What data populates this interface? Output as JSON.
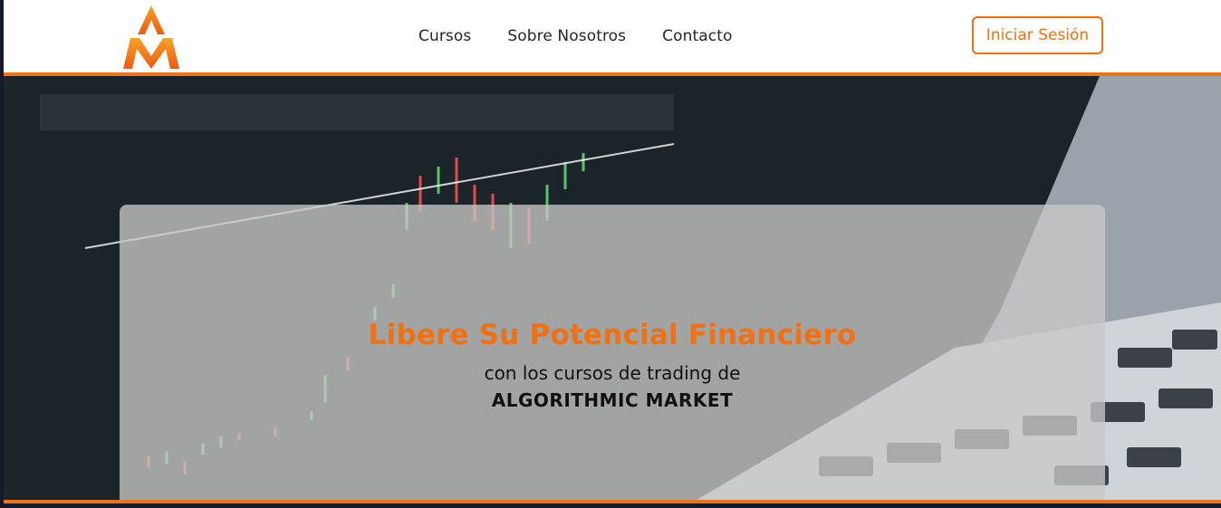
{
  "brand": {
    "logo_icon": "am-logo-icon",
    "accent_color": "#f07014"
  },
  "nav": {
    "items": [
      {
        "label": "Cursos"
      },
      {
        "label": "Sobre Nosotros"
      },
      {
        "label": "Contacto"
      }
    ],
    "login_label": "Iniciar Sesión"
  },
  "hero": {
    "title": "Libere Su Potencial Financiero",
    "subtitle": "con los cursos de trading de",
    "brand_name": "ALGORITHMIC MARKET",
    "background_image": "laptop-trading-chart-photo"
  }
}
